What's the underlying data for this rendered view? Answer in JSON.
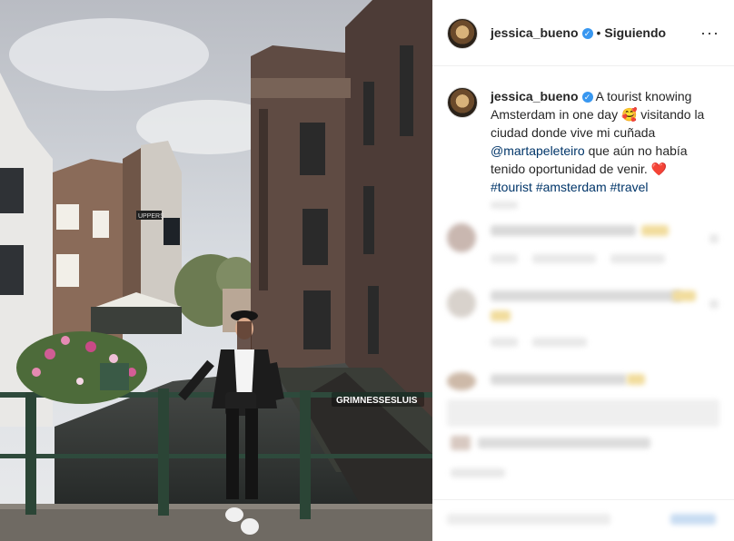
{
  "post": {
    "username": "jessica_bueno",
    "verified_symbol": "✓",
    "separator": "•",
    "follow_status": "Siguiendo",
    "more_symbol": "···"
  },
  "caption": {
    "username": "jessica_bueno",
    "text_1": "A tourist knowing Amsterdam in one day",
    "emoji_1": "🥰",
    "text_2": "visitando la ciudad donde vive mi cuñada",
    "mention": "@martapeleteiro",
    "text_3": "que aún no había tenido oportunidad de venir.",
    "emoji_2": "❤️",
    "hashtags": [
      "#tourist",
      "#amsterdam",
      "#travel"
    ]
  },
  "photo": {
    "tagged_user": "GRIMNESSESLUIS",
    "sign_text": "UPPERS"
  },
  "colors": {
    "link": "#003569",
    "verified": "#3897f0",
    "text": "#262626"
  }
}
